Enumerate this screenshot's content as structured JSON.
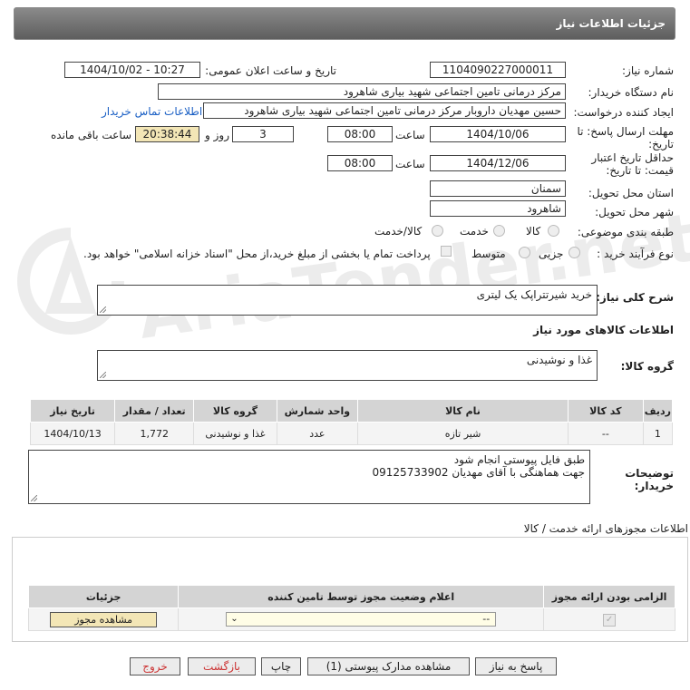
{
  "header": {
    "title": "جزئیات اطلاعات نیاز"
  },
  "watermark": "AriaTender.net",
  "fields": {
    "need_number_label": "شماره نیاز:",
    "need_number": "1104090227000011",
    "announce_label": "تاریخ و ساعت اعلان عمومی:",
    "announce_value": "1404/10/02 - 10:27",
    "buyer_org_label": "نام دستگاه خریدار:",
    "buyer_org": "مرکز درمانی تامین اجتماعی شهید بیاری شاهرود",
    "requester_label": "ایجاد کننده درخواست:",
    "requester": "حسین مهدیان داروبار مرکز درمانی تامین اجتماعی شهید بیاری شاهرود",
    "contact_link": "اطلاعات تماس خریدار",
    "deadline_label_1": "مهلت ارسال پاسخ: تا",
    "deadline_label_2": "تاریخ:",
    "deadline_date": "1404/10/06",
    "time_label": "ساعت",
    "deadline_time": "08:00",
    "days_value": "3",
    "days_label": "روز و",
    "remaining_time": "20:38:44",
    "remaining_label": "ساعت باقی مانده",
    "validity_label_1": "حداقل تاریخ اعتبار",
    "validity_label_2": "قیمت: تا تاریخ:",
    "validity_date": "1404/12/06",
    "validity_time": "08:00",
    "province_label": "استان محل تحویل:",
    "province": "سمنان",
    "city_label": "شهر محل تحویل:",
    "city": "شاهرود",
    "category_label": "طبقه بندی موضوعی:",
    "cat_goods": "کالا",
    "cat_service": "خدمت",
    "cat_both": "کالا/خدمت",
    "process_label": "نوع فرآیند خرید :",
    "proc_partial": "جزیی",
    "proc_medium": "متوسط",
    "payment_note": "پرداخت تمام یا بخشی از مبلغ خرید،از محل \"اسناد خزانه اسلامی\" خواهد بود."
  },
  "description": {
    "label": "شرح کلی نیاز:",
    "value": "خرید شیرتتراپک یک لیتری"
  },
  "goods_info_title": "اطلاعات کالاهای مورد نیاز",
  "goods_group": {
    "label": "گروه کالا:",
    "value": "غذا و نوشیدنی"
  },
  "goods_table": {
    "headers": [
      "ردیف",
      "کد کالا",
      "نام کالا",
      "واحد شمارش",
      "گروه کالا",
      "تعداد / مقدار",
      "تاریخ نیاز"
    ],
    "rows": [
      [
        "1",
        "--",
        "شیر تازه",
        "عدد",
        "غذا و نوشیدنی",
        "1,772",
        "1404/10/13"
      ]
    ]
  },
  "buyer_notes": {
    "label_1": "توضیحات",
    "label_2": "خریدار:",
    "line_1": "طبق فایل پیوستی انجام شود",
    "line_2": "جهت هماهنگی با آقای مهدیان 09125733902"
  },
  "permits": {
    "title": "اطلاعات مجوزهای ارائه خدمت / کالا",
    "headers": [
      "الزامی بودن ارائه مجوز",
      "اعلام وضعیت مجوز توسط تامین کننده",
      "جزئیات"
    ],
    "select_value": "--",
    "view_button": "مشاهده مجوز"
  },
  "buttons": {
    "reply": "پاسخ به نیاز",
    "attachments": "مشاهده مدارک پیوستی (1)",
    "print": "چاپ",
    "back": "بازگشت",
    "exit": "خروج"
  }
}
